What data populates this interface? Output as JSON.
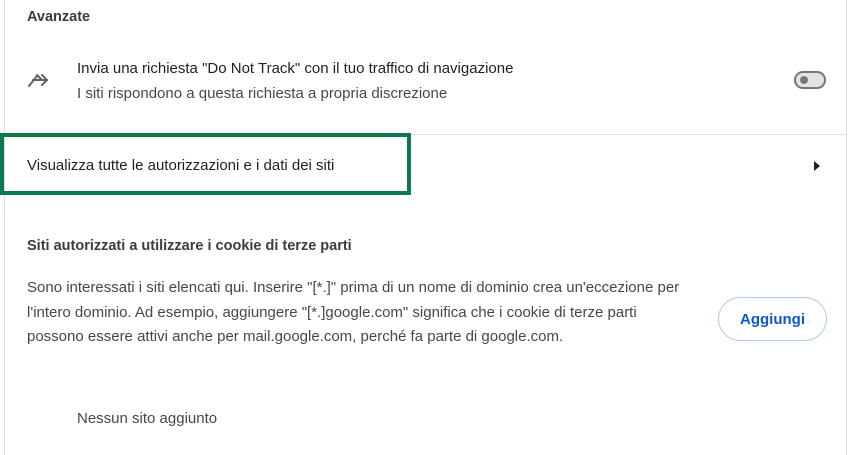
{
  "advanced": {
    "section_title": "Avanzate",
    "do_not_track": {
      "icon": "do-not-track-arrows-icon",
      "title": "Invia una richiesta \"Do Not Track\" con il tuo traffico di navigazione",
      "subtitle": "I siti rispondono a questa richiesta a propria discrezione",
      "toggle_on": false
    },
    "site_permissions": {
      "label": "Visualizza tutte le autorizzazioni e i dati dei siti",
      "icon": "arrow-right-icon",
      "highlight_color": "#0b7a4a"
    }
  },
  "third_party_cookies": {
    "title": "Siti autorizzati a utilizzare i cookie di terze parti",
    "description": "Sono interessati i siti elencati qui. Inserire \"[*.]\" prima di un nome di dominio crea un'eccezione per l'intero dominio. Ad esempio, aggiungere \"[*.]google.com\" significa che i cookie di terze parti possono essere attivi anche per mail.google.com, perché fa parte di google.com.",
    "add_button_label": "Aggiungi",
    "empty_text": "Nessun sito aggiunto"
  },
  "colors": {
    "accent": "#0b57d0",
    "highlight": "#0b7a4a"
  }
}
